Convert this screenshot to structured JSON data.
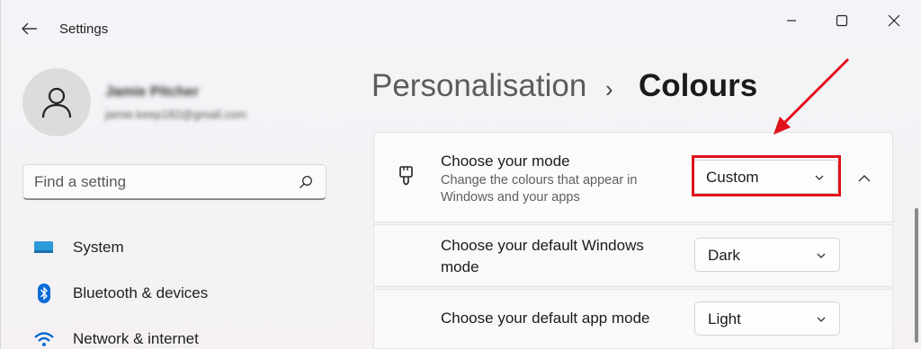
{
  "app": {
    "title": "Settings"
  },
  "profile": {
    "name": "Jamie Pitcher",
    "email": "jamie.keep182@gmail.com"
  },
  "search": {
    "placeholder": "Find a setting"
  },
  "sidebar": {
    "items": [
      {
        "label": "System",
        "icon": "monitor-icon"
      },
      {
        "label": "Bluetooth & devices",
        "icon": "bluetooth-icon"
      },
      {
        "label": "Network & internet",
        "icon": "wifi-icon"
      }
    ]
  },
  "breadcrumb": {
    "parent": "Personalisation",
    "separator": "›",
    "current": "Colours"
  },
  "mode": {
    "title": "Choose your mode",
    "description": "Change the colours that appear in Windows and your apps",
    "value": "Custom",
    "icon": "paintbrush-icon"
  },
  "windows_mode": {
    "label": "Choose your default Windows mode",
    "value": "Dark"
  },
  "app_mode": {
    "label": "Choose your default app mode",
    "value": "Light"
  },
  "colors": {
    "highlight": "#e0121a",
    "accent_blue": "#0a6cd6"
  }
}
